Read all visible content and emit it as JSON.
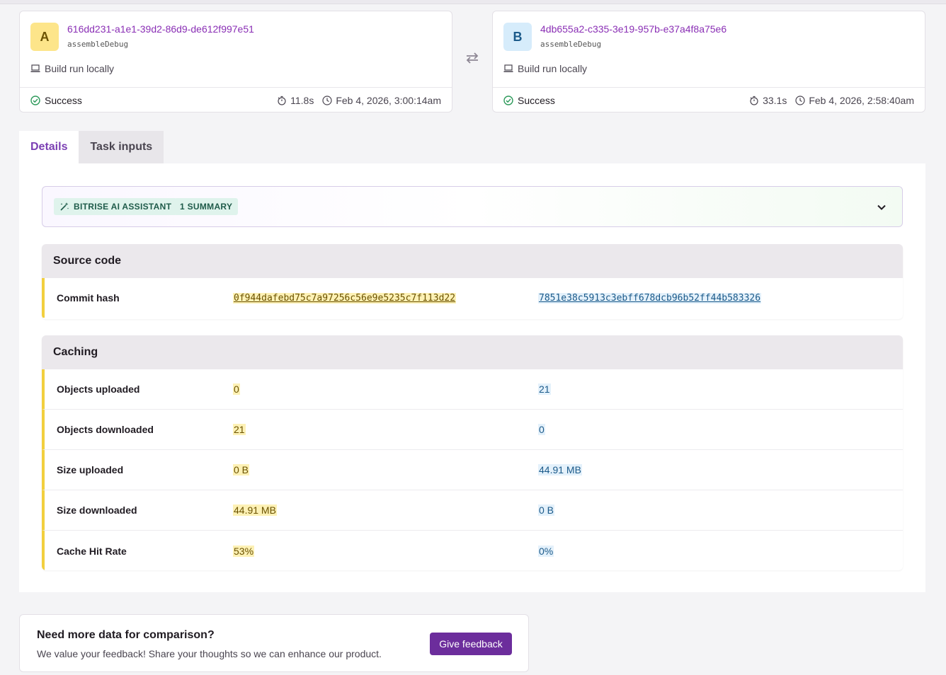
{
  "build_a": {
    "letter": "A",
    "id": "616dd231-a1e1-39d2-86d9-de612f997e51",
    "task": "assembleDebug",
    "run_location": "Build run locally",
    "status": "Success",
    "duration": "11.8s",
    "timestamp": "Feb 4, 2026, 3:00:14am"
  },
  "build_b": {
    "letter": "B",
    "id": "4db655a2-c335-3e19-957b-e37a4f8a75e6",
    "task": "assembleDebug",
    "run_location": "Build run locally",
    "status": "Success",
    "duration": "33.1s",
    "timestamp": "Feb 4, 2026, 2:58:40am"
  },
  "tabs": [
    {
      "label": "Details",
      "active": true
    },
    {
      "label": "Task inputs",
      "active": false
    }
  ],
  "ai_bar": {
    "assistant_label": "BITRISE AI ASSISTANT",
    "summary_label": "1 SUMMARY"
  },
  "source_code": {
    "title": "Source code",
    "rows": [
      {
        "label": "Commit hash",
        "a": "0f944dafebd75c7a97256c56e9e5235c7f113d22",
        "b": "7851e38c5913c3ebff678dcb96b52ff44b583326"
      }
    ]
  },
  "caching": {
    "title": "Caching",
    "rows": [
      {
        "label": "Objects uploaded",
        "a": "0",
        "b": "21"
      },
      {
        "label": "Objects downloaded",
        "a": "21",
        "b": "0"
      },
      {
        "label": "Size uploaded",
        "a": "0 B",
        "b": "44.91 MB"
      },
      {
        "label": "Size downloaded",
        "a": "44.91 MB",
        "b": "0 B"
      },
      {
        "label": "Cache Hit Rate",
        "a": "53%",
        "b": "0%"
      }
    ]
  },
  "feedback": {
    "title": "Need more data for comparison?",
    "text": "We value your feedback! Share your thoughts so we can enhance our product.",
    "button": "Give feedback"
  },
  "colors": {
    "accent": "#7b3fb3",
    "build_a_highlight": "#fdf1b5",
    "build_b_highlight": "#e4f1fb",
    "success": "#2e9a5b",
    "button": "#6c2d9c"
  }
}
